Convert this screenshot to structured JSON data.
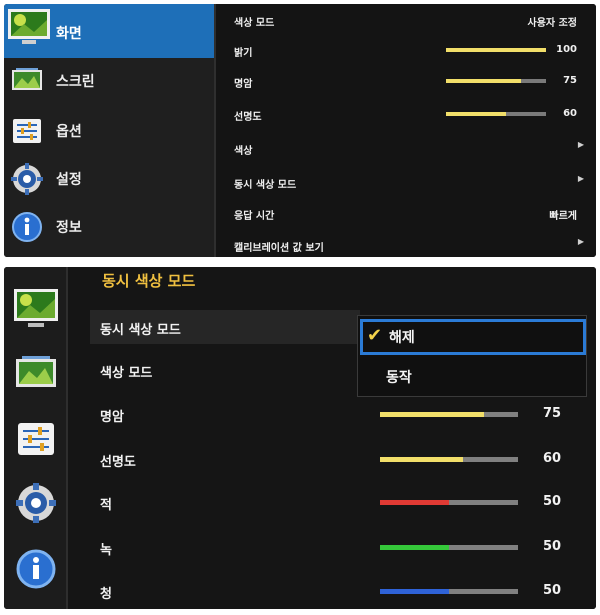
{
  "panel_top": {
    "sidebar": [
      {
        "label": "화면",
        "icon": "picture-icon",
        "active": true
      },
      {
        "label": "스크린",
        "icon": "screen-icon"
      },
      {
        "label": "옵션",
        "icon": "options-icon"
      },
      {
        "label": "설정",
        "icon": "gear-icon"
      },
      {
        "label": "정보",
        "icon": "info-icon"
      }
    ],
    "rows": [
      {
        "name": "색상 모드",
        "value": "사용자 조정"
      },
      {
        "name": "밝기",
        "value": "100",
        "level": 1.0
      },
      {
        "name": "명암",
        "value": "75",
        "level": 0.75
      },
      {
        "name": "선명도",
        "value": "60",
        "level": 0.6
      },
      {
        "name": "색상",
        "arrow": "▶"
      },
      {
        "name": "동시 색상 모드",
        "arrow": "▶"
      },
      {
        "name": "응답 시간",
        "value": "빠르게"
      },
      {
        "name": "캘리브레이션 값 보기",
        "arrow": "▶"
      }
    ]
  },
  "panel_bottom": {
    "title": "동시 색상 모드",
    "rows": [
      {
        "name": "동시 색상 모드"
      },
      {
        "name": "색상 모드"
      },
      {
        "name": "명암",
        "value": "75",
        "level": 0.75,
        "color": "#f2df6a"
      },
      {
        "name": "선명도",
        "value": "60",
        "level": 0.6,
        "color": "#f2df6a"
      },
      {
        "name": "적",
        "value": "50",
        "level": 0.5,
        "color": "#e03a34"
      },
      {
        "name": "녹",
        "value": "50",
        "level": 0.5,
        "color": "#35c83a"
      },
      {
        "name": "청",
        "value": "50",
        "level": 0.5,
        "color": "#2f63d8"
      }
    ],
    "dropdown": {
      "selected": "해제",
      "check": "✔",
      "option2": "동작"
    }
  },
  "colors": {
    "accent": "#1e6fb8",
    "title": "#f0c040",
    "highlight": "#2b7bd6"
  }
}
